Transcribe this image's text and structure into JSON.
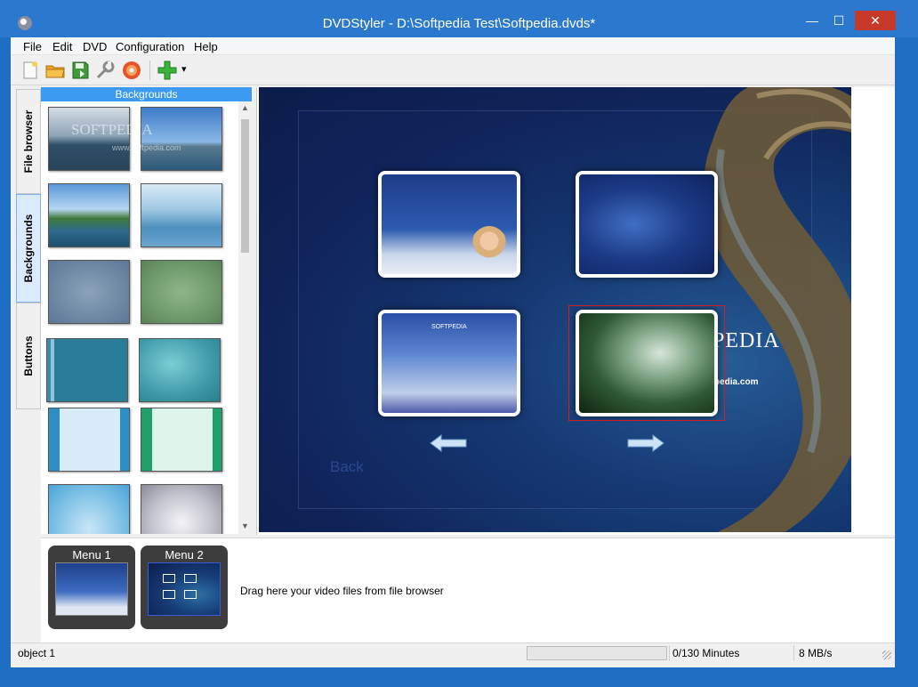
{
  "window": {
    "title": "DVDStyler - D:\\Softpedia Test\\Softpedia.dvds*",
    "minimize_glyph": "—",
    "maximize_glyph": "☐",
    "close_glyph": "✕"
  },
  "menubar": {
    "items": [
      "File",
      "Edit",
      "DVD",
      "Configuration",
      "Help"
    ]
  },
  "toolbar": {
    "buttons": [
      "new-project-icon",
      "open-project-icon",
      "save-project-icon",
      "settings-icon",
      "burn-dvd-icon",
      "add-icon"
    ],
    "dropdown_glyph": "▾"
  },
  "side_tabs": [
    "File browser",
    "Backgrounds",
    "Buttons"
  ],
  "backgrounds_panel": {
    "title": "Backgrounds",
    "watermark": "SOFTPEDIA",
    "watermark_url": "www.softpedia.com"
  },
  "canvas": {
    "back_label": "Back",
    "brand_text": "PEDIA",
    "brand_url": "pedia.com",
    "button_softpedia_label": "SOFTPEDIA"
  },
  "titleset": {
    "menus": [
      "Menu 1",
      "Menu 2"
    ],
    "drag_hint": "Drag here your video files from file browser"
  },
  "status": {
    "object": "object 1",
    "minutes": "0/130 Minutes",
    "rate": "8 MB/s"
  },
  "colors": {
    "accent": "#3c9bf0",
    "titlebar": "#2b78cf",
    "close": "#c7392b",
    "selection": "#d41e1e"
  }
}
